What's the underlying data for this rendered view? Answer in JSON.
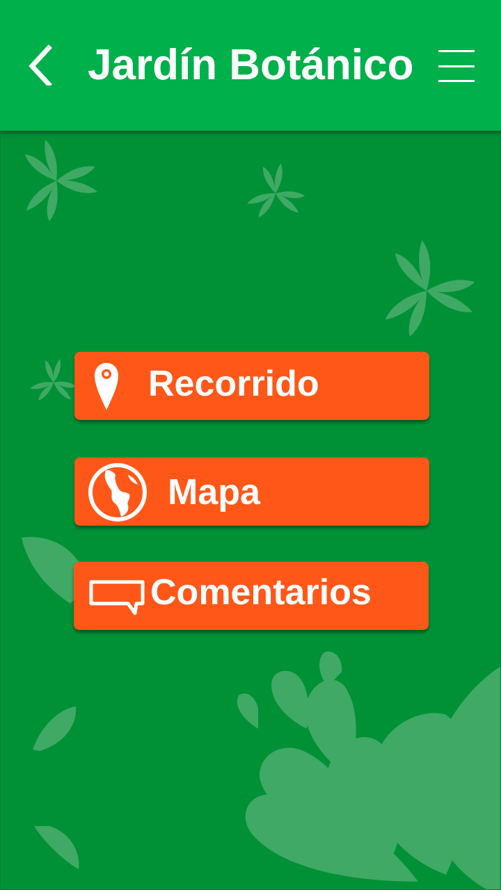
{
  "header": {
    "title": "Jardín Botánico",
    "back_icon": "chevron-left-icon",
    "menu_icon": "hamburger-menu-icon"
  },
  "menu": {
    "items": [
      {
        "label": "Recorrido",
        "icon": "map-pin-icon"
      },
      {
        "label": "Mapa",
        "icon": "globe-icon"
      },
      {
        "label": "Comentarios",
        "icon": "comment-bubble-icon"
      }
    ]
  },
  "colors": {
    "app_bar": "#00b04a",
    "background": "#009136",
    "button": "#ff5718",
    "decor": "#4cae6e",
    "text": "#ffffff"
  }
}
